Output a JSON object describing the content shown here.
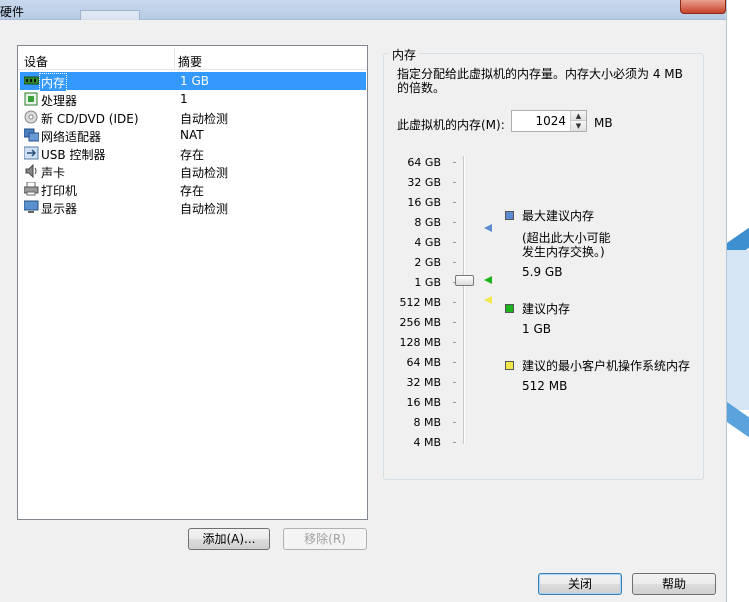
{
  "window": {
    "title": "硬件"
  },
  "device_list": {
    "col_device": "设备",
    "col_summary": "摘要",
    "rows": [
      {
        "name": "内存",
        "summary": "1 GB",
        "icon": "memory-icon"
      },
      {
        "name": "处理器",
        "summary": "1",
        "icon": "processor-icon"
      },
      {
        "name": "新 CD/DVD (IDE)",
        "summary": "自动检测",
        "icon": "cd-dvd-icon"
      },
      {
        "name": "网络适配器",
        "summary": "NAT",
        "icon": "network-adapter-icon"
      },
      {
        "name": "USB 控制器",
        "summary": "存在",
        "icon": "usb-icon"
      },
      {
        "name": "声卡",
        "summary": "自动检测",
        "icon": "sound-card-icon"
      },
      {
        "name": "打印机",
        "summary": "存在",
        "icon": "printer-icon"
      },
      {
        "name": "显示器",
        "summary": "自动检测",
        "icon": "display-icon"
      }
    ]
  },
  "buttons": {
    "add": "添加(A)...",
    "remove": "移除(R)",
    "close": "关闭",
    "help": "帮助"
  },
  "memory": {
    "group_title": "内存",
    "description": "指定分配给此虚拟机的内存量。内存大小必须为 4 MB 的倍数。",
    "field_label": "此虚拟机的内存(M):",
    "value": "1024",
    "unit": "MB",
    "scale_labels": [
      "64 GB",
      "32 GB",
      "16 GB",
      "8 GB",
      "4 GB",
      "2 GB",
      "1 GB",
      "512 MB",
      "256 MB",
      "128 MB",
      "64 MB",
      "32 MB",
      "16 MB",
      "8 MB",
      "4 MB"
    ],
    "current_level": "1 GB",
    "legend": {
      "max_title": "最大建议内存",
      "max_note_1": "(超出此大小可能",
      "max_note_2": "发生内存交换。)",
      "max_value": "5.9 GB",
      "recommended_title": "建议内存",
      "recommended_value": "1 GB",
      "min_title": "建议的最小客户机操作系统内存",
      "min_value": "512 MB"
    },
    "colors": {
      "max": "#5b8bd0",
      "recommended": "#1db31d",
      "min": "#f1e94a"
    }
  }
}
